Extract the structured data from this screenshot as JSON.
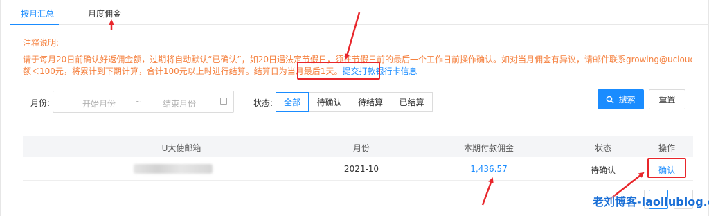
{
  "tabs": {
    "monthly_summary": "按月汇总",
    "monthly_commission": "月度佣金"
  },
  "notice": {
    "title": "注释说明:",
    "line1": "请于每月20日前确认好返佣金额，过期将自动默认“已确认”，如20日遇法定节假日，须在节假日前的最后一个工作日前操作确认。如对当月佣金有异议，请邮件联系growing@ucloud.cn。另若当期佣金金",
    "line2": "额＜100元，将累计到下期计算，合计100元以上时进行结算。结算日为当月最后1天。",
    "link": "提交打款银行卡信息"
  },
  "filters": {
    "month_label": "月份:",
    "start_placeholder": "开始月份",
    "separator": "~",
    "end_placeholder": "结束月份",
    "status_label": "状态:",
    "status_options": [
      "全部",
      "待确认",
      "待结算",
      "已结算"
    ],
    "search": "搜索",
    "reset": "重置"
  },
  "table": {
    "headers": [
      "U大使邮箱",
      "月份",
      "本期付款佣金",
      "状态",
      "操作"
    ],
    "rows": [
      {
        "email": "",
        "month": "2021-10",
        "amount": "1,436.57",
        "status": "待确认",
        "action": "确认"
      }
    ]
  },
  "watermark": "老刘博客-laoliublog.cn",
  "colors": {
    "accent": "#1a8cff",
    "notice": "#f5803e",
    "highlight": "#e8262b"
  }
}
